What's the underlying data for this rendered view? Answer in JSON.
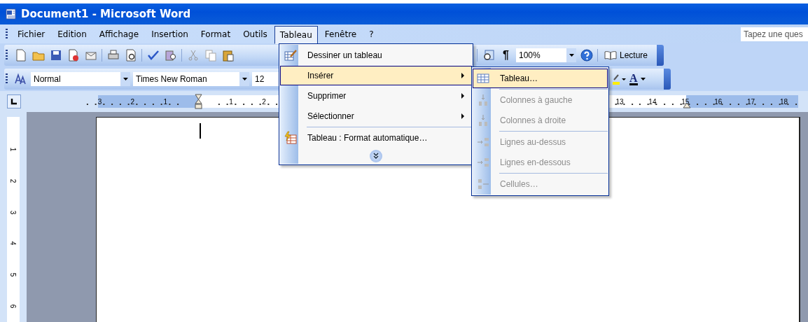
{
  "window": {
    "title": "Document1 - Microsoft Word"
  },
  "menu_bar": {
    "items": [
      {
        "label": "Fichier",
        "selected": false
      },
      {
        "label": "Edition",
        "selected": false
      },
      {
        "label": "Affichage",
        "selected": false
      },
      {
        "label": "Insertion",
        "selected": false
      },
      {
        "label": "Format",
        "selected": false
      },
      {
        "label": "Outils",
        "selected": false
      },
      {
        "label": "Tableau",
        "selected": true
      },
      {
        "label": "Fenêtre",
        "selected": false
      },
      {
        "label": "?",
        "selected": false
      }
    ],
    "help_box": {
      "placeholder": "Tapez une ques"
    }
  },
  "standard_toolbar": {
    "show_marks": "¶",
    "zoom": "100%",
    "reading_button": "Lecture"
  },
  "formatting_toolbar": {
    "style": "Normal",
    "font": "Times New Roman",
    "size": "12",
    "font_color": "A"
  },
  "ruler": {
    "left_numbers": [
      "3",
      "2",
      "1"
    ],
    "inner_numbers": [
      "1",
      "2"
    ],
    "far_numbers": [
      "13",
      "14",
      "15",
      "16",
      "17",
      "18"
    ]
  },
  "vertical_ruler": {
    "numbers": [
      "1",
      "2",
      "3",
      "4",
      "5",
      "6"
    ]
  },
  "table_menu": {
    "items": [
      {
        "label": "Dessiner un tableau",
        "kind": "command",
        "selected": false,
        "separator_before": false
      },
      {
        "label": "Insérer",
        "kind": "submenu",
        "selected": true,
        "separator_before": false
      },
      {
        "label": "Supprimer",
        "kind": "submenu",
        "selected": false,
        "separator_before": false
      },
      {
        "label": "Sélectionner",
        "kind": "submenu",
        "selected": false,
        "separator_before": false
      },
      {
        "label": "Tableau : Format automatique…",
        "kind": "command",
        "selected": false,
        "separator_before": true
      }
    ]
  },
  "insert_submenu": {
    "items": [
      {
        "label": "Tableau…",
        "selected": true,
        "disabled": false,
        "separator_before": false
      },
      {
        "label": "Colonnes à gauche",
        "selected": false,
        "disabled": true,
        "separator_before": true
      },
      {
        "label": "Colonnes à droite",
        "selected": false,
        "disabled": true,
        "separator_before": false
      },
      {
        "label": "Lignes au-dessus",
        "selected": false,
        "disabled": true,
        "separator_before": true
      },
      {
        "label": "Lignes en-dessous",
        "selected": false,
        "disabled": true,
        "separator_before": false
      },
      {
        "label": "Cellules…",
        "selected": false,
        "disabled": true,
        "separator_before": true
      }
    ]
  }
}
